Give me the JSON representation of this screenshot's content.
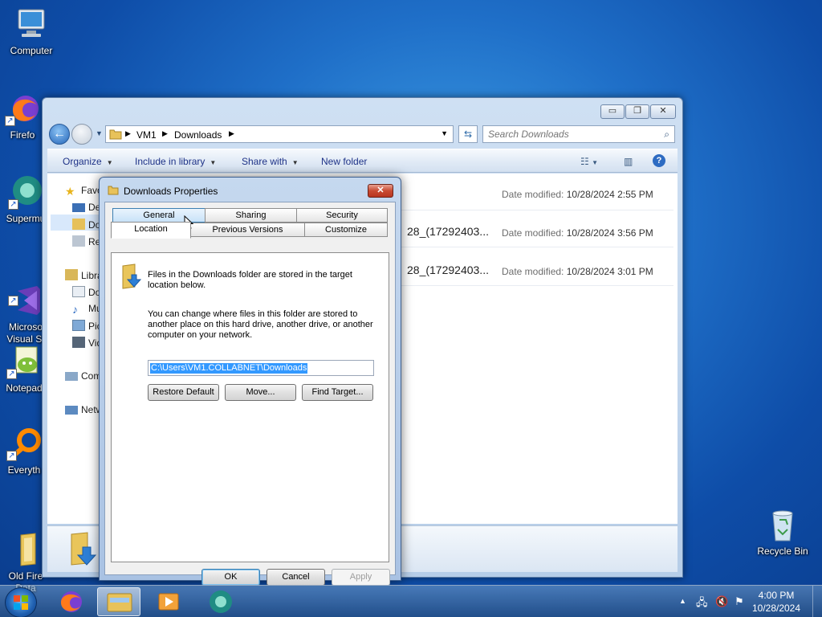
{
  "desktop": {
    "icons": [
      {
        "label": "Computer"
      },
      {
        "label": "Firefo"
      },
      {
        "label": "Supermu"
      },
      {
        "label": "Microso\nVisual St"
      },
      {
        "label": "Notepad"
      },
      {
        "label": "Everyth"
      },
      {
        "label": "Old Fire\nData"
      },
      {
        "label": "Recycle Bin"
      }
    ]
  },
  "explorer": {
    "breadcrumb": [
      "VM1",
      "Downloads"
    ],
    "search_placeholder": "Search Downloads",
    "toolbar": {
      "organize": "Organize",
      "include": "Include in library",
      "share": "Share with",
      "new_folder": "New folder"
    },
    "nav": {
      "favorites": "Favo",
      "desktop": "De",
      "downloads": "Do",
      "recent": "Re",
      "libraries": "Libra",
      "documents": "Do",
      "music": "Mu",
      "pictures": "Pic",
      "videos": "Vid",
      "computer": "Com",
      "network": "Netw"
    },
    "files": [
      {
        "name": "",
        "modified_label": "Date modified:",
        "modified": "10/28/2024 2:55 PM"
      },
      {
        "name": "28_(17292403...",
        "modified_label": "Date modified:",
        "modified": "10/28/2024 3:56 PM"
      },
      {
        "name": "28_(17292403...",
        "modified_label": "Date modified:",
        "modified": "10/28/2024 3:01 PM"
      }
    ]
  },
  "dialog": {
    "title": "Downloads Properties",
    "tabs": {
      "general": "General",
      "sharing": "Sharing",
      "security": "Security",
      "location": "Location",
      "previous_versions": "Previous Versions",
      "customize": "Customize"
    },
    "intro_line1": "Files in the Downloads folder are stored in the target",
    "intro_line2": "location below.",
    "change_line1": "You can change where files in this folder are stored to",
    "change_line2": "another place on this hard drive, another drive, or another",
    "change_line3": "computer on your network.",
    "path": "C:\\Users\\VM1.COLLABNET\\Downloads",
    "buttons": {
      "restore": "Restore Default",
      "move": "Move...",
      "find": "Find Target...",
      "ok": "OK",
      "cancel": "Cancel",
      "apply": "Apply"
    }
  },
  "taskbar": {
    "time": "4:00 PM",
    "date": "10/28/2024"
  }
}
